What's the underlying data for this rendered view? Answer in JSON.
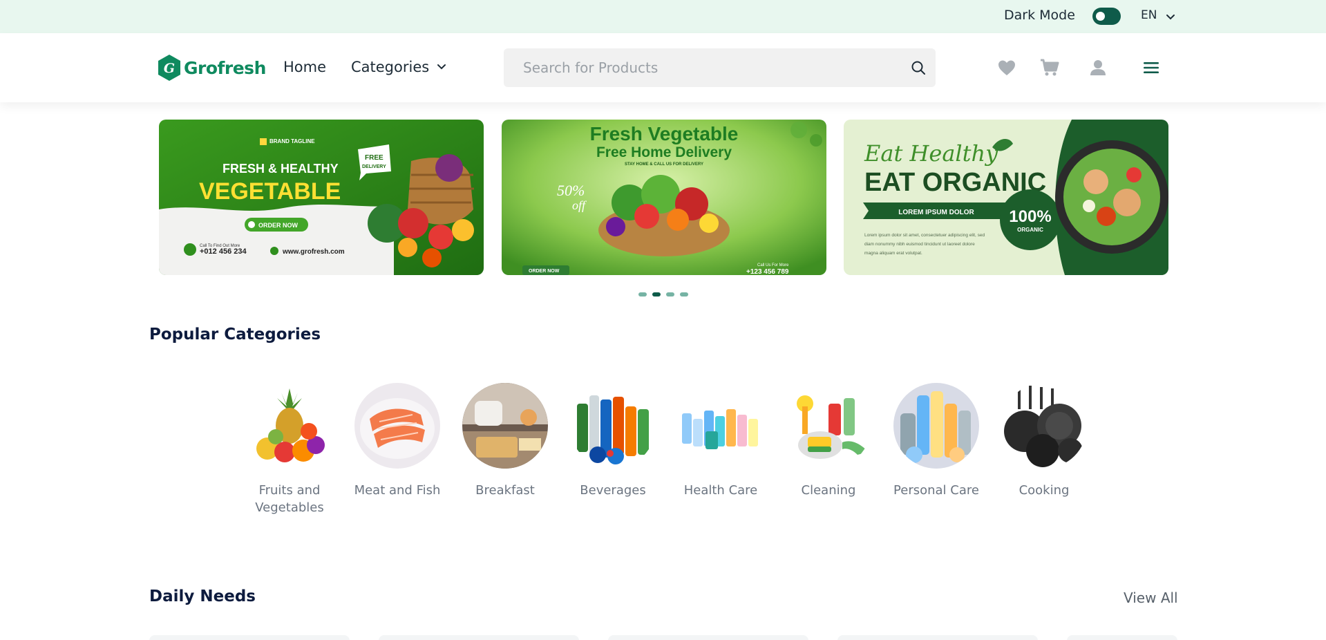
{
  "topbar": {
    "dark_mode_label": "Dark Mode",
    "dark_mode_on": false,
    "language": "EN"
  },
  "header": {
    "brand": "Grofresh",
    "nav": {
      "home": "Home",
      "categories": "Categories"
    },
    "search_placeholder": "Search for Products",
    "icons": [
      "heart-icon",
      "cart-icon",
      "user-icon",
      "menu-icon"
    ]
  },
  "banners": [
    {
      "tagline": "BRAND TAGLINE",
      "headline": "FRESH & HEALTHY",
      "title": "VEGETABLE",
      "badge": "FREE DELIVERY",
      "cta": "ORDER NOW",
      "call_text": "Call To Find Out More",
      "phone": "+012 456 234",
      "website": "www.grofresh.com"
    },
    {
      "title": "Fresh Vegetable",
      "subtitle": "Free Home Delivery",
      "note": "STAY HOME & CALL US FOR DELIVERY",
      "discount": "50% off",
      "cta": "ORDER NOW",
      "call_text": "Call Us For More",
      "phone": "+123 456 789"
    },
    {
      "script_title": "Eat Healthy",
      "title": "EAT ORGANIC",
      "ribbon": "LOREM IPSUM DOLOR",
      "body": "Lorem ipsum dolor sit amet, consectetuer adipiscing elit, sed diam nonummy nibh euismod tincidunt ut laoreet dolore magna aliquam erat volutpat.",
      "seal_value": "100%",
      "seal_label": "ORGANIC"
    }
  ],
  "carousel": {
    "dot_count": 4,
    "active_index": 1
  },
  "popular_categories": {
    "title": "Popular Categories",
    "items": [
      {
        "label": "Fruits and Vegetables"
      },
      {
        "label": "Meat and Fish"
      },
      {
        "label": "Breakfast"
      },
      {
        "label": "Beverages"
      },
      {
        "label": "Health Care"
      },
      {
        "label": "Cleaning"
      },
      {
        "label": "Personal Care"
      },
      {
        "label": "Cooking"
      }
    ]
  },
  "daily_needs": {
    "title": "Daily Needs",
    "view_all": "View All"
  },
  "colors": {
    "brand_green": "#0f8a5f",
    "dark_green": "#0f5b4a",
    "topbar_bg": "#e8f7ef",
    "heading": "#0d1b3e"
  }
}
